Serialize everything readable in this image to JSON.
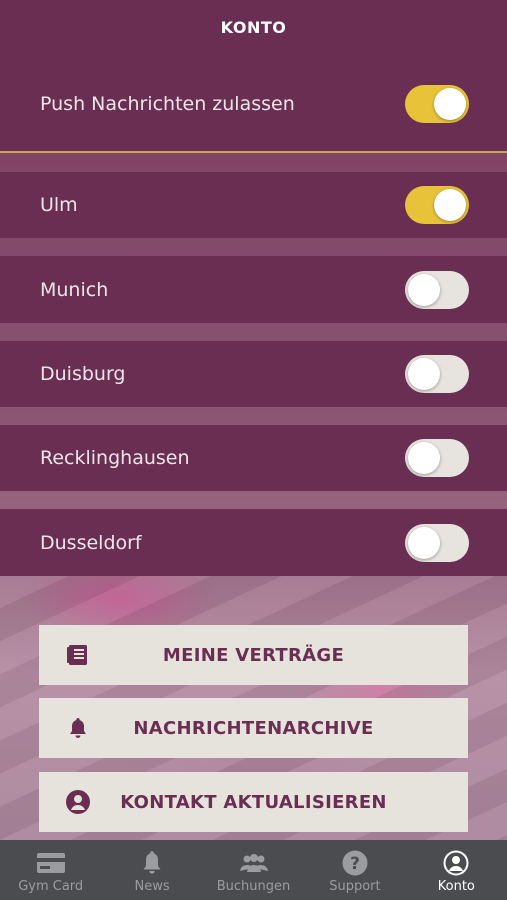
{
  "header": {
    "title": "KONTO"
  },
  "push": {
    "label": "Push Nachrichten zulassen",
    "enabled": true
  },
  "locations": [
    {
      "label": "Ulm",
      "enabled": true
    },
    {
      "label": "Munich",
      "enabled": false
    },
    {
      "label": "Duisburg",
      "enabled": false
    },
    {
      "label": "Recklinghausen",
      "enabled": false
    },
    {
      "label": "Dusseldorf",
      "enabled": false
    }
  ],
  "buttons": {
    "contracts": {
      "label": "MEINE VERTRÄGE",
      "icon": "document-icon"
    },
    "archive": {
      "label": "NACHRICHTENARCHIVE",
      "icon": "bell-icon"
    },
    "contact": {
      "label": "KONTAKT AKTUALISIEREN",
      "icon": "user-circle-icon"
    }
  },
  "tabs": [
    {
      "label": "Gym Card",
      "icon": "card-icon",
      "active": false
    },
    {
      "label": "News",
      "icon": "bell-icon",
      "active": false
    },
    {
      "label": "Buchungen",
      "icon": "group-icon",
      "active": false
    },
    {
      "label": "Support",
      "icon": "question-icon",
      "active": false
    },
    {
      "label": "Konto",
      "icon": "user-circle-icon",
      "active": true
    }
  ],
  "colors": {
    "primary": "#6a2e52",
    "toggle_on": "#e8c33a",
    "toggle_off": "#e7e3df",
    "button_bg": "#e6e2dc",
    "tabbar_bg": "#4a4c50"
  }
}
